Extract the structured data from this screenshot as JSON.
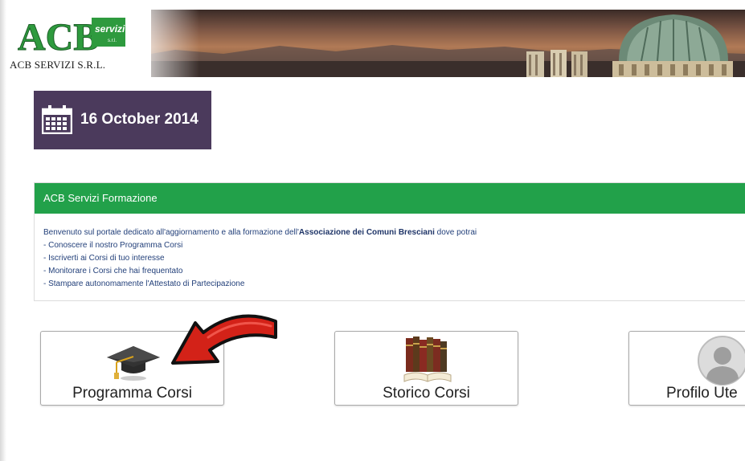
{
  "header": {
    "logo_letters": "ACB",
    "logo_badge": "servizi",
    "logo_badge_sub": "s.r.l.",
    "company_name": "ACB SERVIZI S.R.L."
  },
  "date_tile": {
    "icon": "calendar-icon",
    "date": "16 October 2014"
  },
  "panel": {
    "title": "ACB Servizi Formazione",
    "intro_before": "Benvenuto sul portale dedicato all'aggiornamento e alla formazione dell'",
    "intro_bold": "Associazione dei Comuni Bresciani",
    "intro_after": " dove potrai",
    "items": [
      "- Conoscere il nostro Programma Corsi",
      "- Iscriverti ai Corsi di tuo interesse",
      "- Monitorare i Corsi che hai frequentato",
      "- Stampare autonomamente l'Attestato di Partecipazione"
    ]
  },
  "tiles": [
    {
      "label": "Programma Corsi",
      "icon": "graduation-cap-icon"
    },
    {
      "label": "Storico Corsi",
      "icon": "books-icon"
    },
    {
      "label": "Profilo Ute",
      "icon": "user-avatar-icon"
    }
  ],
  "colors": {
    "date_tile_bg": "#4b3a5c",
    "panel_header_bg": "#22a14a",
    "logo_green": "#2e9a3e",
    "arrow_red": "#d32218"
  }
}
